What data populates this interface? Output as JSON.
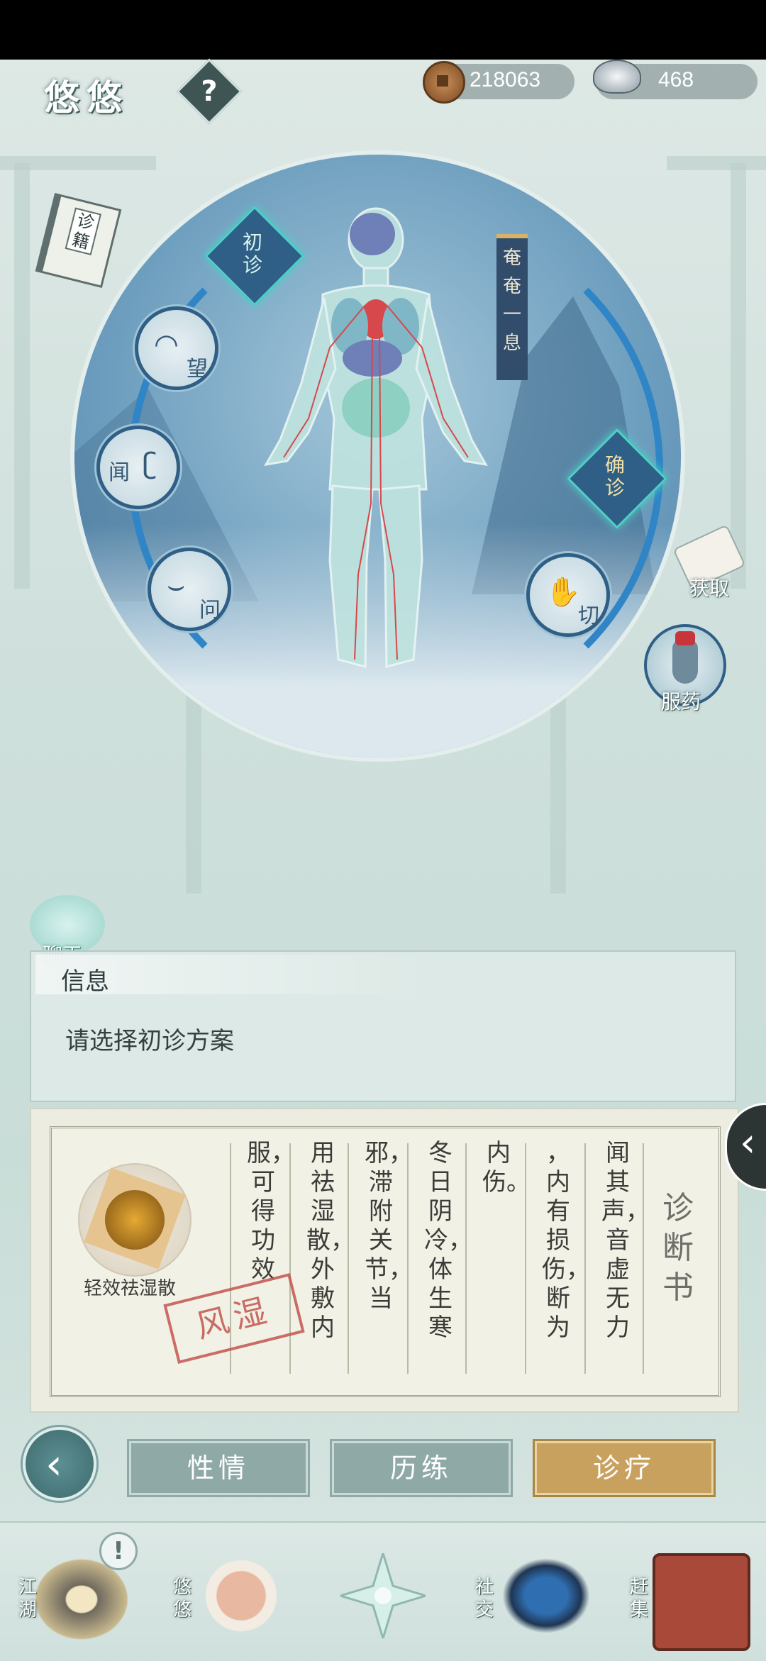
{
  "header": {
    "title": "悠悠",
    "help_label": "?",
    "copper_coins": "218063",
    "silver": "468",
    "copper_icon": "copper-coin-icon",
    "silver_icon": "silver-ingot-icon"
  },
  "top_left": {
    "book_label": "诊籍"
  },
  "diagnosis": {
    "first_diag": "初诊",
    "confirm_diag": "确诊",
    "methods": [
      {
        "label": "望"
      },
      {
        "label": "闻"
      },
      {
        "label": "问"
      },
      {
        "label": "切"
      }
    ],
    "status_banner": "奄奄一息"
  },
  "side": {
    "obtain_label": "获取",
    "medicine_label": "服药"
  },
  "chat": {
    "label": "聊天"
  },
  "info": {
    "title": "信息",
    "message": "请选择初诊方案"
  },
  "diagnosis_book": {
    "title": "诊断书",
    "columns": [
      "闻其声，音虚无力",
      "，内有损伤，断为",
      "内伤。",
      "冬日阴冷，体生寒",
      "邪，滞附关节，当",
      "用祛湿散，外敷内",
      "服，可得功效"
    ],
    "remedy_name": "轻效祛湿散",
    "stamp": "风湿",
    "toggle_icon": "chevron-left-icon"
  },
  "tabs": {
    "back_icon": "back-arrow-icon",
    "items": [
      {
        "label": "性情",
        "active": false
      },
      {
        "label": "历练",
        "active": false
      },
      {
        "label": "诊疗",
        "active": true
      }
    ]
  },
  "bottom_nav": {
    "items": [
      {
        "label": "江湖"
      },
      {
        "label": "悠悠"
      },
      {
        "label": "社交"
      },
      {
        "label": "赶集"
      }
    ],
    "alert": "!"
  },
  "colors": {
    "accent_teal": "#4fd0c7",
    "circle_blue": "#4e81a8",
    "active_tab": "#c8a15e",
    "inactive_tab": "#8fa9a7"
  }
}
